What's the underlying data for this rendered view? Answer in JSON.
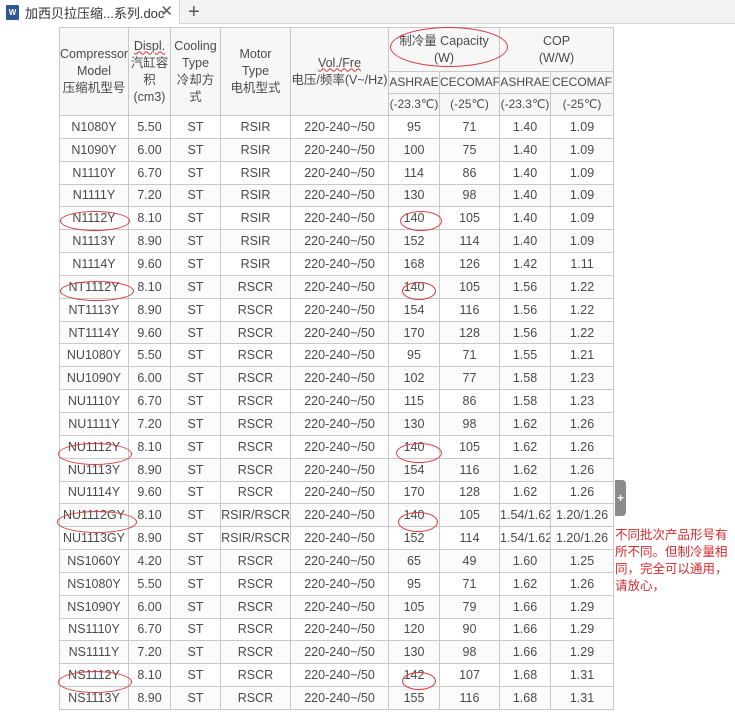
{
  "tab": {
    "icon_text": "W",
    "title": "加西贝拉压缩...系列.doc",
    "close_symbol": "✕",
    "add_symbol": "+"
  },
  "table": {
    "headers": {
      "model": [
        "Compressor",
        "Model",
        "压缩机型号"
      ],
      "displ": [
        "Displ.",
        "汽缸容",
        "积",
        "(cm3)"
      ],
      "cooling": [
        "Cooling",
        "Type",
        "冷却方",
        "式"
      ],
      "motor": [
        "Motor",
        "Type",
        "电机型式"
      ],
      "vol": [
        "Vol./Fre",
        "电压/频率(V~/Hz)"
      ],
      "capacity": [
        "制冷量 Capacity",
        "(W)"
      ],
      "cop": [
        "COP",
        "(W/W)"
      ],
      "ashrae": "ASHRAE",
      "cecomaf": "CECOMAF",
      "temp_ashrae": "(-23.3℃)",
      "temp_cecomaf": "(-25℃)"
    },
    "rows": [
      [
        "N1080Y",
        "5.50",
        "ST",
        "RSIR",
        "220-240~/50",
        "95",
        "71",
        "1.40",
        "1.09"
      ],
      [
        "N1090Y",
        "6.00",
        "ST",
        "RSIR",
        "220-240~/50",
        "100",
        "75",
        "1.40",
        "1.09"
      ],
      [
        "N1110Y",
        "6.70",
        "ST",
        "RSIR",
        "220-240~/50",
        "114",
        "86",
        "1.40",
        "1.09"
      ],
      [
        "N1111Y",
        "7.20",
        "ST",
        "RSIR",
        "220-240~/50",
        "130",
        "98",
        "1.40",
        "1.09"
      ],
      [
        "N1112Y",
        "8.10",
        "ST",
        "RSIR",
        "220-240~/50",
        "140",
        "105",
        "1.40",
        "1.09"
      ],
      [
        "N1113Y",
        "8.90",
        "ST",
        "RSIR",
        "220-240~/50",
        "152",
        "114",
        "1.40",
        "1.09"
      ],
      [
        "N1114Y",
        "9.60",
        "ST",
        "RSIR",
        "220-240~/50",
        "168",
        "126",
        "1.42",
        "1.11"
      ],
      [
        "NT1112Y",
        "8.10",
        "ST",
        "RSCR",
        "220-240~/50",
        "140",
        "105",
        "1.56",
        "1.22"
      ],
      [
        "NT1113Y",
        "8.90",
        "ST",
        "RSCR",
        "220-240~/50",
        "154",
        "116",
        "1.56",
        "1.22"
      ],
      [
        "NT1114Y",
        "9.60",
        "ST",
        "RSCR",
        "220-240~/50",
        "170",
        "128",
        "1.56",
        "1.22"
      ],
      [
        "NU1080Y",
        "5.50",
        "ST",
        "RSCR",
        "220-240~/50",
        "95",
        "71",
        "1.55",
        "1.21"
      ],
      [
        "NU1090Y",
        "6.00",
        "ST",
        "RSCR",
        "220-240~/50",
        "102",
        "77",
        "1.58",
        "1.23"
      ],
      [
        "NU1110Y",
        "6.70",
        "ST",
        "RSCR",
        "220-240~/50",
        "115",
        "86",
        "1.58",
        "1.23"
      ],
      [
        "NU1111Y",
        "7.20",
        "ST",
        "RSCR",
        "220-240~/50",
        "130",
        "98",
        "1.62",
        "1.26"
      ],
      [
        "NU1112Y",
        "8.10",
        "ST",
        "RSCR",
        "220-240~/50",
        "140",
        "105",
        "1.62",
        "1.26"
      ],
      [
        "NU1113Y",
        "8.90",
        "ST",
        "RSCR",
        "220-240~/50",
        "154",
        "116",
        "1.62",
        "1.26"
      ],
      [
        "NU1114Y",
        "9.60",
        "ST",
        "RSCR",
        "220-240~/50",
        "170",
        "128",
        "1.62",
        "1.26"
      ],
      [
        "NU1112GY",
        "8.10",
        "ST",
        "RSIR/RSCR",
        "220-240~/50",
        "140",
        "105",
        "1.54/1.62",
        "1.20/1.26"
      ],
      [
        "NU1113GY",
        "8.90",
        "ST",
        "RSIR/RSCR",
        "220-240~/50",
        "152",
        "114",
        "1.54/1.62",
        "1.20/1.26"
      ],
      [
        "NS1060Y",
        "4.20",
        "ST",
        "RSCR",
        "220-240~/50",
        "65",
        "49",
        "1.60",
        "1.25"
      ],
      [
        "NS1080Y",
        "5.50",
        "ST",
        "RSCR",
        "220-240~/50",
        "95",
        "71",
        "1.62",
        "1.26"
      ],
      [
        "NS1090Y",
        "6.00",
        "ST",
        "RSCR",
        "220-240~/50",
        "105",
        "79",
        "1.66",
        "1.29"
      ],
      [
        "NS1110Y",
        "6.70",
        "ST",
        "RSCR",
        "220-240~/50",
        "120",
        "90",
        "1.66",
        "1.29"
      ],
      [
        "NS1111Y",
        "7.20",
        "ST",
        "RSCR",
        "220-240~/50",
        "130",
        "98",
        "1.66",
        "1.29"
      ],
      [
        "NS1112Y",
        "8.10",
        "ST",
        "RSCR",
        "220-240~/50",
        "142",
        "107",
        "1.68",
        "1.31"
      ],
      [
        "NS1113Y",
        "8.90",
        "ST",
        "RSCR",
        "220-240~/50",
        "155",
        "116",
        "1.68",
        "1.31"
      ]
    ]
  },
  "expander_symbol": "+",
  "note": "不同批次产品形号有所不同。但制冷量相同，完全可以通用，请放心，",
  "colors": {
    "annotation_red": "#d93a3a",
    "word_blue": "#2b5797"
  }
}
